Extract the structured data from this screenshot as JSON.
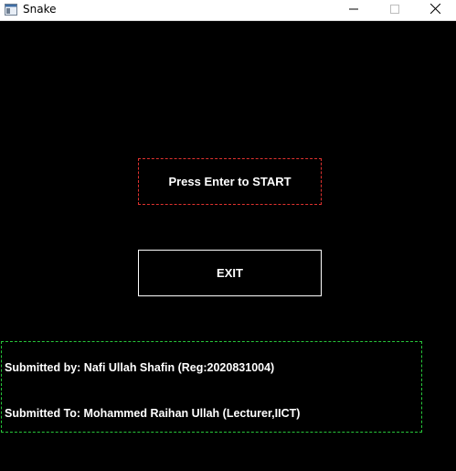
{
  "window": {
    "title": "Snake",
    "icon": "app-window-icon",
    "controls": [
      "minimize-icon",
      "maximize-icon",
      "close-icon"
    ]
  },
  "menu": {
    "start_label": "Press Enter to START",
    "exit_label": "EXIT"
  },
  "info": {
    "submitted_by": "Submitted by: Nafi Ullah Shafin (Reg:2020831004)",
    "submitted_to": "Submitted To: Mohammed Raihan Ullah (Lecturer,IICT)"
  },
  "colors": {
    "background": "#000000",
    "start_border": "#e0322f",
    "exit_border": "#ffffff",
    "info_border": "#27c63a",
    "text": "#ffffff"
  }
}
